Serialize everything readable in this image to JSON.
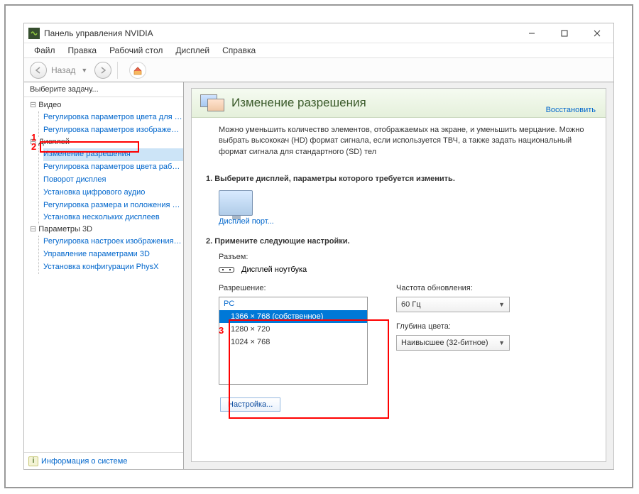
{
  "window": {
    "title": "Панель управления NVIDIA"
  },
  "menu": {
    "file": "Файл",
    "edit": "Правка",
    "desktop": "Рабочий стол",
    "display": "Дисплей",
    "help": "Справка"
  },
  "nav": {
    "back_label": "Назад"
  },
  "sidebar": {
    "header": "Выберите задачу...",
    "video": {
      "label": "Видео",
      "items": [
        "Регулировка параметров цвета для вид",
        "Регулировка параметров изображения д"
      ]
    },
    "display": {
      "label": "Дисплей",
      "items": [
        "Изменение разрешения",
        "Регулировка параметров цвета рабочег",
        "Поворот дисплея",
        "Установка цифрового аудио",
        "Регулировка размера и положения рабо",
        "Установка нескольких дисплеев"
      ]
    },
    "params3d": {
      "label": "Параметры 3D",
      "items": [
        "Регулировка настроек изображения с пр",
        "Управление параметрами 3D",
        "Установка конфигурации PhysX"
      ]
    },
    "footer": "Информация о системе"
  },
  "content": {
    "title": "Изменение разрешения",
    "restore": "Восстановить",
    "desc": "Можно уменьшить количество элементов, отображаемых на экране, и уменьшить мерцание. Можно выбрать высококач (HD) формат сигнала, если используется ТВЧ, а также задать национальный формат сигнала для стандартного (SD) тел",
    "step1": "1. Выберите дисплей, параметры которого требуется изменить.",
    "display_label": "Дисплей порт...",
    "step2": "2. Примените следующие настройки.",
    "connector_label": "Разъем:",
    "connector_value": "Дисплей ноутбука",
    "resolution_label": "Разрешение:",
    "res_heading": "PC",
    "resolutions": [
      "1366 × 768 (собственное)",
      "1280 × 720",
      "1024 × 768"
    ],
    "refresh_label": "Частота обновления:",
    "refresh_value": "60 Гц",
    "depth_label": "Глубина цвета:",
    "depth_value": "Наивысшее (32-битное)",
    "config_btn": "Настройка..."
  },
  "markers": {
    "m1": "1",
    "m2": "2",
    "m3": "3"
  }
}
